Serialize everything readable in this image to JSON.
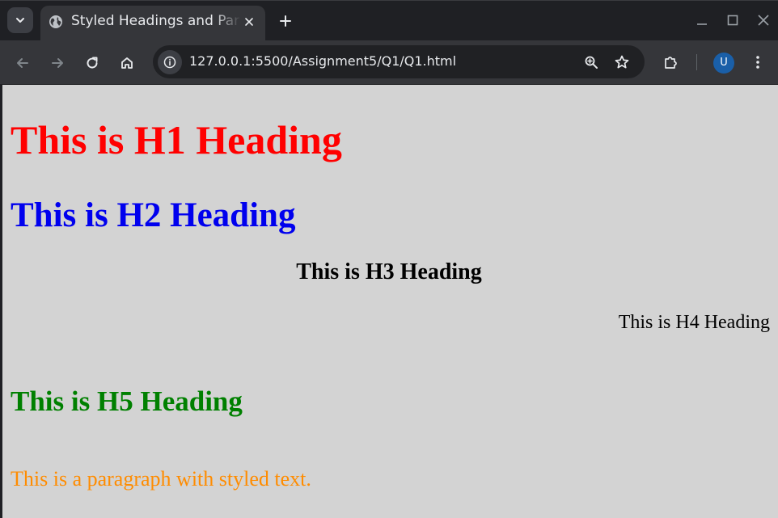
{
  "browser": {
    "tab": {
      "title": "Styled Headings and Paragraphs",
      "favicon": "globe-icon"
    },
    "toolbar": {
      "url": "127.0.0.1:5500/Assignment5/Q1/Q1.html",
      "avatar_initial": "U"
    },
    "colors": {
      "tabstrip": "#1f2024",
      "toolbar": "#35363a",
      "omnibox": "#202124",
      "avatar": "#1a5fa8"
    }
  },
  "page": {
    "background": "#d3d3d3",
    "h1": {
      "text": "This is H1 Heading",
      "color": "#ff0000"
    },
    "h2": {
      "text": "This is H2 Heading",
      "color": "#0000ee"
    },
    "h3": {
      "text": "This is H3 Heading",
      "color": "#000000"
    },
    "h4": {
      "text": "This is H4 Heading",
      "color": "#000000"
    },
    "h5": {
      "text": "This is H5 Heading",
      "color": "#008000"
    },
    "paragraph": {
      "text": "This is a paragraph with styled text.",
      "color": "#ff8c00"
    }
  }
}
